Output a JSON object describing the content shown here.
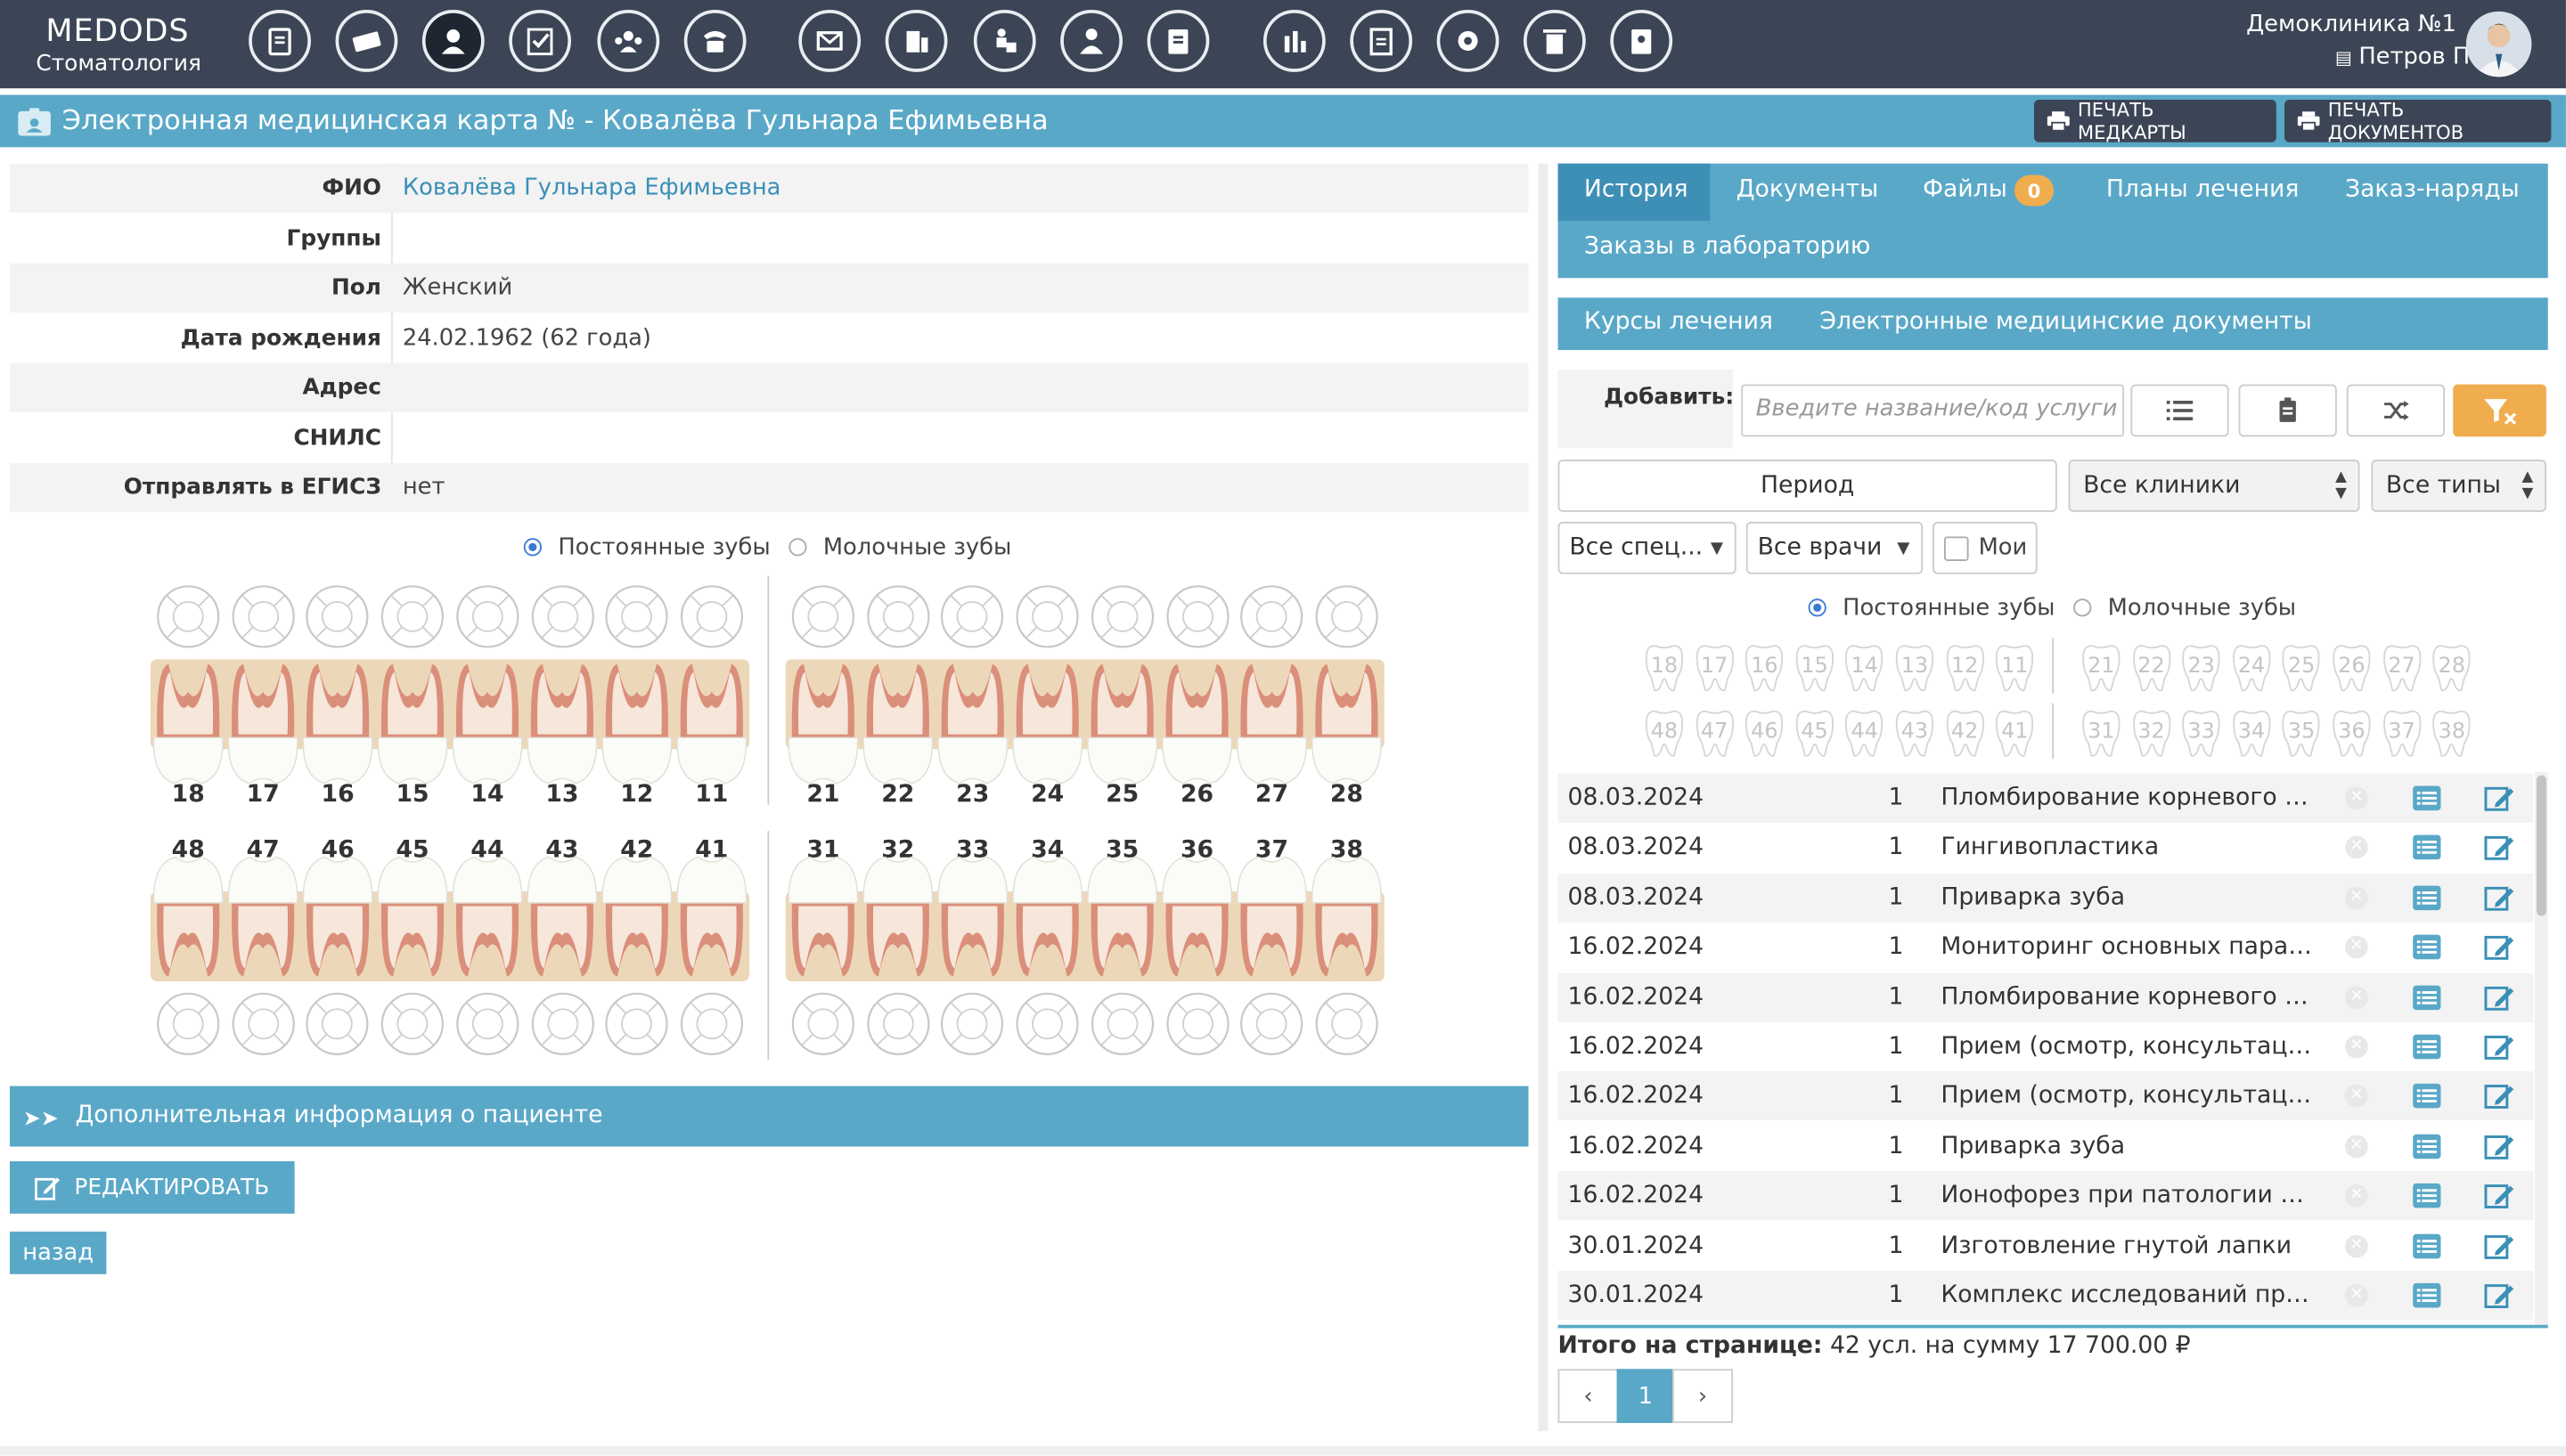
{
  "app": {
    "logo_title": "MEDODS",
    "logo_subtitle": "Стоматология",
    "clinic": "Демоклиника №1",
    "user": "Петров Петр"
  },
  "nav_icons": [
    "document-edit-icon",
    "ticket-icon",
    "patient-card-icon",
    "checklist-icon",
    "call-center-icon",
    "phone-icon",
    "mail-icon",
    "pharmacy-icon",
    "reception-icon",
    "doctor-icon",
    "journal-icon",
    "analytics-icon",
    "reports-icon",
    "settings-icon",
    "trash-icon",
    "address-book-icon"
  ],
  "header": {
    "title": "Электронная медицинская карта № - Ковалёва Гульнара Ефимьевна",
    "print_card": "ПЕЧАТЬ МЕДКАРТЫ",
    "print_docs": "ПЕЧАТЬ ДОКУМЕНТОВ"
  },
  "patient": {
    "rows": [
      {
        "label": "ФИО",
        "value": "Ковалёва Гульнара Ефимьевна"
      },
      {
        "label": "Группы",
        "value": ""
      },
      {
        "label": "Пол",
        "value": "Женский"
      },
      {
        "label": "Дата рождения",
        "value": "24.02.1962 (62 года)"
      },
      {
        "label": "Адрес",
        "value": ""
      },
      {
        "label": "СНИЛС",
        "value": ""
      },
      {
        "label": "Отправлять в ЕГИСЗ",
        "value": "нет"
      }
    ]
  },
  "teeth": {
    "permanent_label": "Постоянные зубы",
    "milk_label": "Молочные зубы",
    "upper_left": [
      "18",
      "17",
      "16",
      "15",
      "14",
      "13",
      "12",
      "11"
    ],
    "upper_right": [
      "21",
      "22",
      "23",
      "24",
      "25",
      "26",
      "27",
      "28"
    ],
    "lower_left": [
      "48",
      "47",
      "46",
      "45",
      "44",
      "43",
      "42",
      "41"
    ],
    "lower_right": [
      "31",
      "32",
      "33",
      "34",
      "35",
      "36",
      "37",
      "38"
    ]
  },
  "additional_info": "Дополнительная информация о пациенте",
  "buttons": {
    "edit": "РЕДАКТИРОВАТЬ",
    "back": "назад"
  },
  "tabs": {
    "history": "История",
    "documents": "Документы",
    "files": "Файлы",
    "files_count": "0",
    "plans": "Планы лечения",
    "orders": "Заказ-наряды",
    "lab_orders": "Заказы в лабораторию",
    "courses": "Курсы лечения",
    "emd": "Электронные медицинские документы"
  },
  "filters": {
    "add_label": "Добавить:",
    "service_placeholder": "Введите название/код услуги",
    "period": "Период",
    "clinics": "Все клиники",
    "types": "Все типы",
    "specialties": "Все спец...",
    "doctors": "Все врачи",
    "mine": "Мои"
  },
  "history": [
    {
      "date": "08.03.2024",
      "qty": "1",
      "name": "Пломбирование корневого к..."
    },
    {
      "date": "08.03.2024",
      "qty": "1",
      "name": "Гингивопластика"
    },
    {
      "date": "08.03.2024",
      "qty": "1",
      "name": "Приварка зуба"
    },
    {
      "date": "16.02.2024",
      "qty": "1",
      "name": "Мониторинг основных парам..."
    },
    {
      "date": "16.02.2024",
      "qty": "1",
      "name": "Пломбирование корневого к..."
    },
    {
      "date": "16.02.2024",
      "qty": "1",
      "name": "Прием (осмотр, консультаци..."
    },
    {
      "date": "16.02.2024",
      "qty": "1",
      "name": "Прием (осмотр, консультаци..."
    },
    {
      "date": "16.02.2024",
      "qty": "1",
      "name": "Приварка зуба"
    },
    {
      "date": "16.02.2024",
      "qty": "1",
      "name": "Ионофорез при патологии п..."
    },
    {
      "date": "30.01.2024",
      "qty": "1",
      "name": "Изготовление гнутой лапки"
    },
    {
      "date": "30.01.2024",
      "qty": "1",
      "name": "Комплекс исследований пре..."
    }
  ],
  "totals": {
    "label": "Итого на странице:",
    "text": "42 усл. на сумму 17 700.00 ₽"
  },
  "pagination": {
    "current": "1",
    "prev": "‹",
    "next": "›"
  },
  "colors": {
    "accent": "#5aa8c8",
    "topbar": "#3b4555",
    "badge": "#f0ad4e"
  }
}
